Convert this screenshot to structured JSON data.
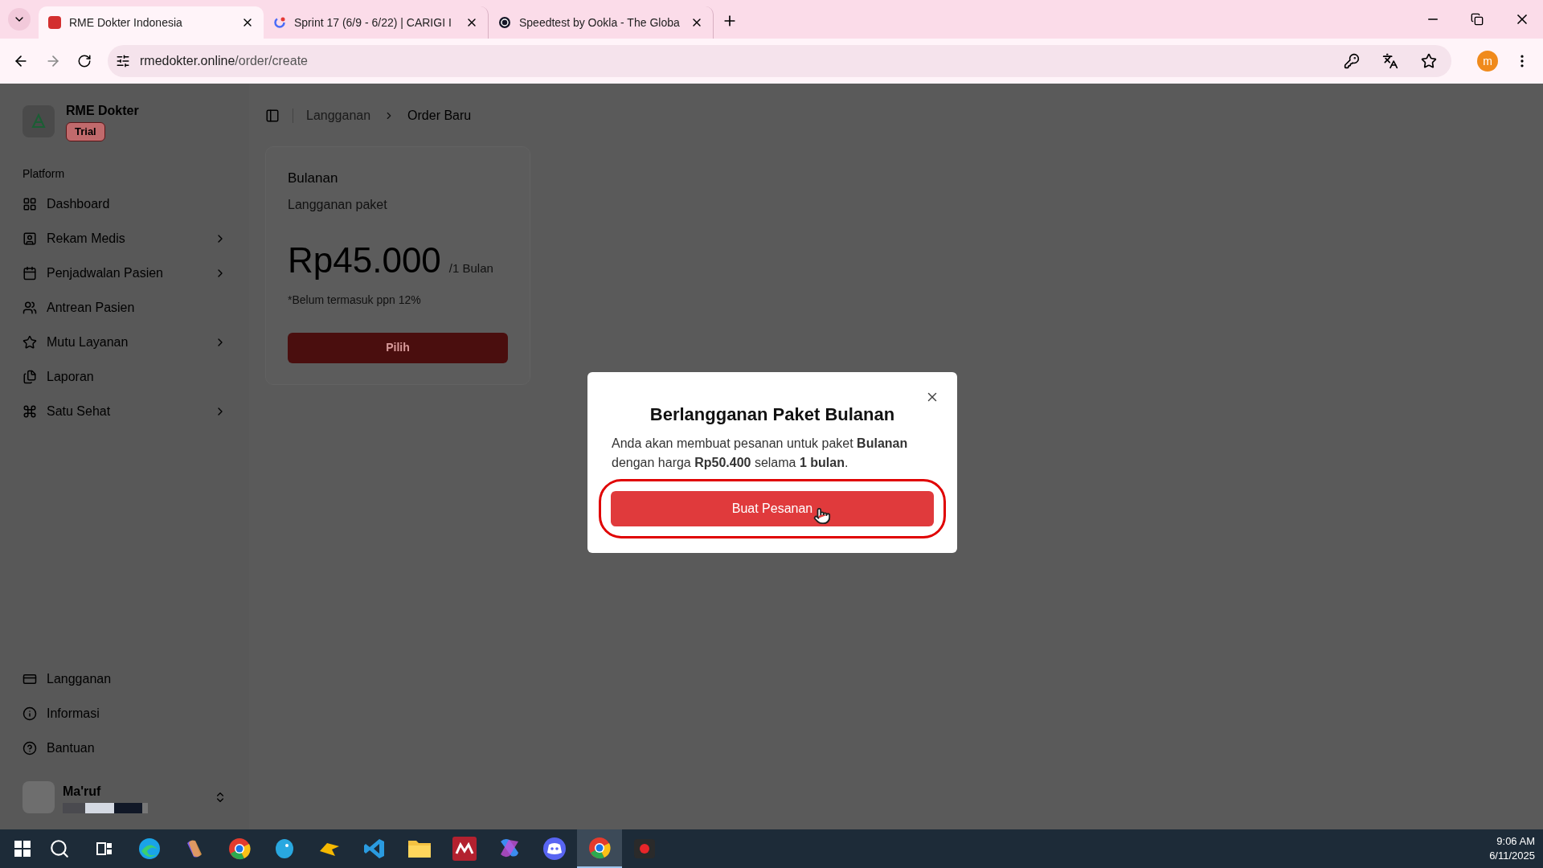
{
  "browser": {
    "tabs": [
      {
        "title": "RME Dokter Indonesia",
        "selected": true
      },
      {
        "title": "Sprint 17 (6/9 - 6/22) | CARIGI I",
        "selected": false
      },
      {
        "title": "Speedtest by Ookla - The Globa",
        "selected": false
      }
    ],
    "url_host": "rmedokter.online",
    "url_path": "/order/create",
    "profile_initial": "m"
  },
  "app": {
    "brand": "RME Dokter",
    "badge": "Trial",
    "section": "Platform",
    "nav": [
      {
        "label": "Dashboard",
        "expandable": false
      },
      {
        "label": "Rekam Medis",
        "expandable": true
      },
      {
        "label": "Penjadwalan Pasien",
        "expandable": true
      },
      {
        "label": "Antrean Pasien",
        "expandable": false
      },
      {
        "label": "Mutu Layanan",
        "expandable": true
      },
      {
        "label": "Laporan",
        "expandable": false
      },
      {
        "label": "Satu Sehat",
        "expandable": true
      }
    ],
    "footer_nav": [
      {
        "label": "Langganan"
      },
      {
        "label": "Informasi"
      },
      {
        "label": "Bantuan"
      }
    ],
    "user": {
      "name": "Ma'ruf"
    },
    "breadcrumb": [
      "Langganan",
      "Order Baru"
    ],
    "plan": {
      "title": "Bulanan",
      "subtitle": "Langganan paket",
      "price": "Rp45.000",
      "period": "/1 Bulan",
      "note": "*Belum termasuk ppn 12%",
      "button": "Pilih"
    }
  },
  "dialog": {
    "title": "Berlangganan Paket Bulanan",
    "body": "Anda akan membuat pesanan untuk paket **Bulanan** dengan harga **Rp50.400** selama **1 bulan**.",
    "button": "Buat Pesanan",
    "highlighted": true
  },
  "taskbar": {
    "items": [
      {
        "kind": "search",
        "selected": false
      },
      {
        "kind": "taskview",
        "selected": false
      },
      {
        "kind": "edge",
        "selected": false
      },
      {
        "kind": "copilot",
        "selected": false
      },
      {
        "kind": "chrome",
        "selected": false
      },
      {
        "kind": "bluebird",
        "selected": false
      },
      {
        "kind": "yellowbird",
        "selected": false
      },
      {
        "kind": "vscode",
        "selected": false
      },
      {
        "kind": "folder",
        "selected": false
      },
      {
        "kind": "mendeley",
        "selected": false
      },
      {
        "kind": "m365",
        "selected": false
      },
      {
        "kind": "discord",
        "selected": false
      },
      {
        "kind": "chrome",
        "selected": true
      },
      {
        "kind": "recorder",
        "selected": false
      }
    ],
    "time": "9:06 AM",
    "date": "6/11/2025"
  }
}
